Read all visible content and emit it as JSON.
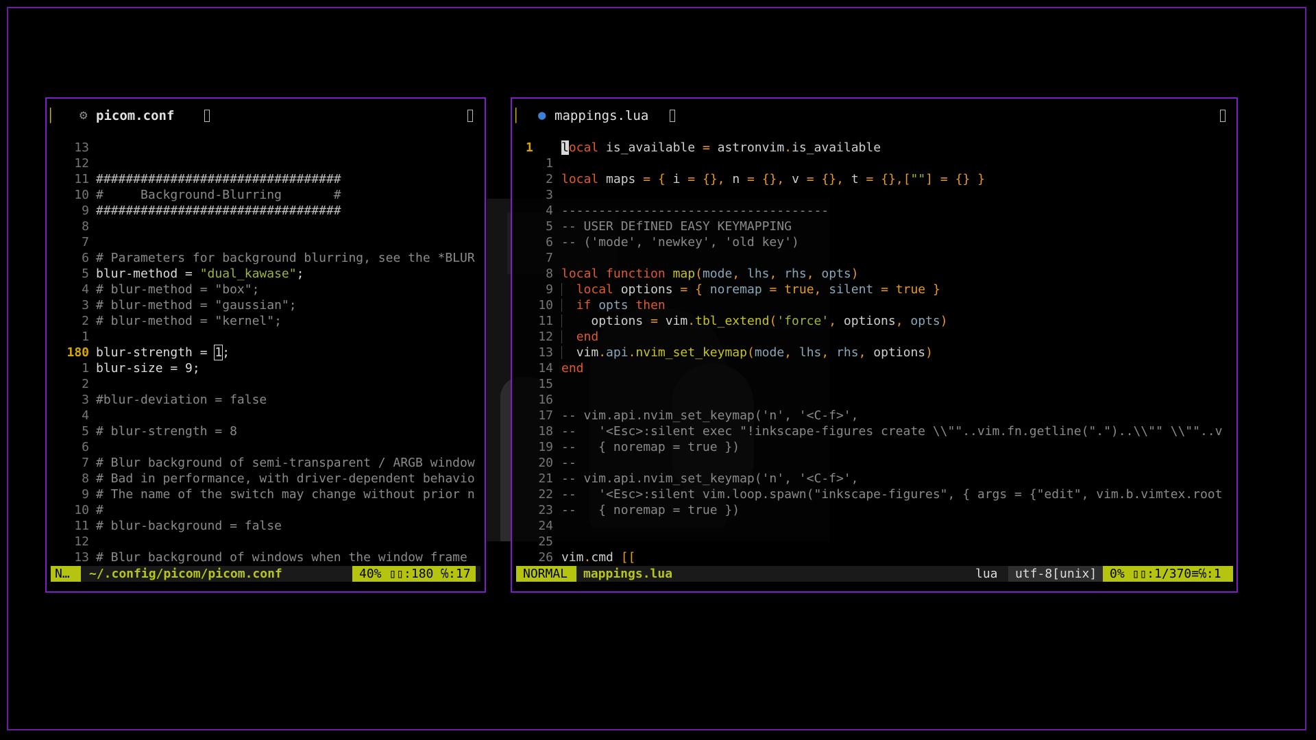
{
  "left": {
    "tab_title": "picom.conf",
    "tab_icon": "gear-icon",
    "lines": [
      {
        "n": "13",
        "t": "",
        "c": "cm"
      },
      {
        "n": "12",
        "t": "",
        "c": "cm"
      },
      {
        "n": "11",
        "t": "#################################",
        "c": "hs"
      },
      {
        "n": "10",
        "t": "#     Background-Blurring       #",
        "c": "cm"
      },
      {
        "n": "9",
        "t": "#################################",
        "c": "hs"
      },
      {
        "n": "8",
        "t": "",
        "c": "cm"
      },
      {
        "n": "7",
        "t": "",
        "c": "cm"
      },
      {
        "n": "6",
        "t": "# Parameters for background blurring, see the *BLUR",
        "c": "cm"
      },
      {
        "n": "5",
        "t": "blur-method = \"dual_kawase\";",
        "c": "mix1"
      },
      {
        "n": "4",
        "t": "# blur-method = \"box\";",
        "c": "cm"
      },
      {
        "n": "3",
        "t": "# blur-method = \"gaussian\";",
        "c": "cm"
      },
      {
        "n": "2",
        "t": "# blur-method = \"kernel\";",
        "c": "cm"
      },
      {
        "n": "1",
        "t": "",
        "c": "cm"
      },
      {
        "n": "180",
        "t": "blur-strength = 1;",
        "c": "curline"
      },
      {
        "n": "1",
        "t": "blur-size = 9;",
        "c": "pl"
      },
      {
        "n": "2",
        "t": "",
        "c": "cm"
      },
      {
        "n": "3",
        "t": "#blur-deviation = false",
        "c": "cm"
      },
      {
        "n": "4",
        "t": "",
        "c": "cm"
      },
      {
        "n": "5",
        "t": "# blur-strength = 8",
        "c": "cm"
      },
      {
        "n": "6",
        "t": "",
        "c": "cm"
      },
      {
        "n": "7",
        "t": "# Blur background of semi-transparent / ARGB window",
        "c": "cm"
      },
      {
        "n": "8",
        "t": "# Bad in performance, with driver-dependent behavio",
        "c": "cm"
      },
      {
        "n": "9",
        "t": "# The name of the switch may change without prior n",
        "c": "cm"
      },
      {
        "n": "10",
        "t": "#",
        "c": "cm"
      },
      {
        "n": "11",
        "t": "# blur-background = false",
        "c": "cm"
      },
      {
        "n": "12",
        "t": "",
        "c": "cm"
      },
      {
        "n": "13",
        "t": "# Blur background of windows when the window frame",
        "c": "cm"
      }
    ],
    "status": {
      "mode": "N…",
      "file": "~/.config/picom/picom.conf",
      "pos": "40% ▯▯:180 ℅:17"
    }
  },
  "right": {
    "tab_title": "mappings.lua",
    "tab_icon": "lua-moon-icon",
    "lines": [
      {
        "n": "1",
        "t": "local is_available = astronvim.is_available"
      },
      {
        "n": "1",
        "t": ""
      },
      {
        "n": "2",
        "t": "local maps = { i = {}, n = {}, v = {}, t = {},[\"\"] = {} }"
      },
      {
        "n": "3",
        "t": ""
      },
      {
        "n": "4",
        "t": "------------------------------------"
      },
      {
        "n": "5",
        "t": "-- USER DEfINED EASY KEYMAPPING"
      },
      {
        "n": "6",
        "t": "-- ('mode', 'newkey', 'old key')"
      },
      {
        "n": "7",
        "t": ""
      },
      {
        "n": "8",
        "t": "local function map(mode, lhs, rhs, opts)"
      },
      {
        "n": "9",
        "t": "  local options = { noremap = true, silent = true }"
      },
      {
        "n": "10",
        "t": "  if opts then"
      },
      {
        "n": "11",
        "t": "    options = vim.tbl_extend('force', options, opts)"
      },
      {
        "n": "12",
        "t": "  end"
      },
      {
        "n": "13",
        "t": "  vim.api.nvim_set_keymap(mode, lhs, rhs, options)"
      },
      {
        "n": "14",
        "t": "end"
      },
      {
        "n": "15",
        "t": ""
      },
      {
        "n": "16",
        "t": ""
      },
      {
        "n": "17",
        "t": "-- vim.api.nvim_set_keymap('n', '<C-f>',"
      },
      {
        "n": "18",
        "t": "--   '<Esc>:silent exec \"!inkscape-figures create \\\\\"\"..vim.fn.getline(\".\")..\\\\\"\" \\\\\"\"..v"
      },
      {
        "n": "19",
        "t": "--   { noremap = true })"
      },
      {
        "n": "20",
        "t": "--"
      },
      {
        "n": "21",
        "t": "-- vim.api.nvim_set_keymap('n', '<C-f>',"
      },
      {
        "n": "22",
        "t": "--   '<Esc>:silent vim.loop.spawn(\"inkscape-figures\", { args = {\"edit\", vim.b.vimtex.root"
      },
      {
        "n": "23",
        "t": "--   { noremap = true })"
      },
      {
        "n": "24",
        "t": ""
      },
      {
        "n": "25",
        "t": ""
      },
      {
        "n": "26",
        "t": "vim.cmd [["
      }
    ],
    "status": {
      "mode": "NORMAL",
      "file": "mappings.lua",
      "ft": "lua",
      "enc": "utf-8[unix]",
      "pos": "0% ▯▯:1/370≡℅:1"
    }
  },
  "colors": {
    "border": "#7c1fc8",
    "accent": "#b5c40f"
  }
}
